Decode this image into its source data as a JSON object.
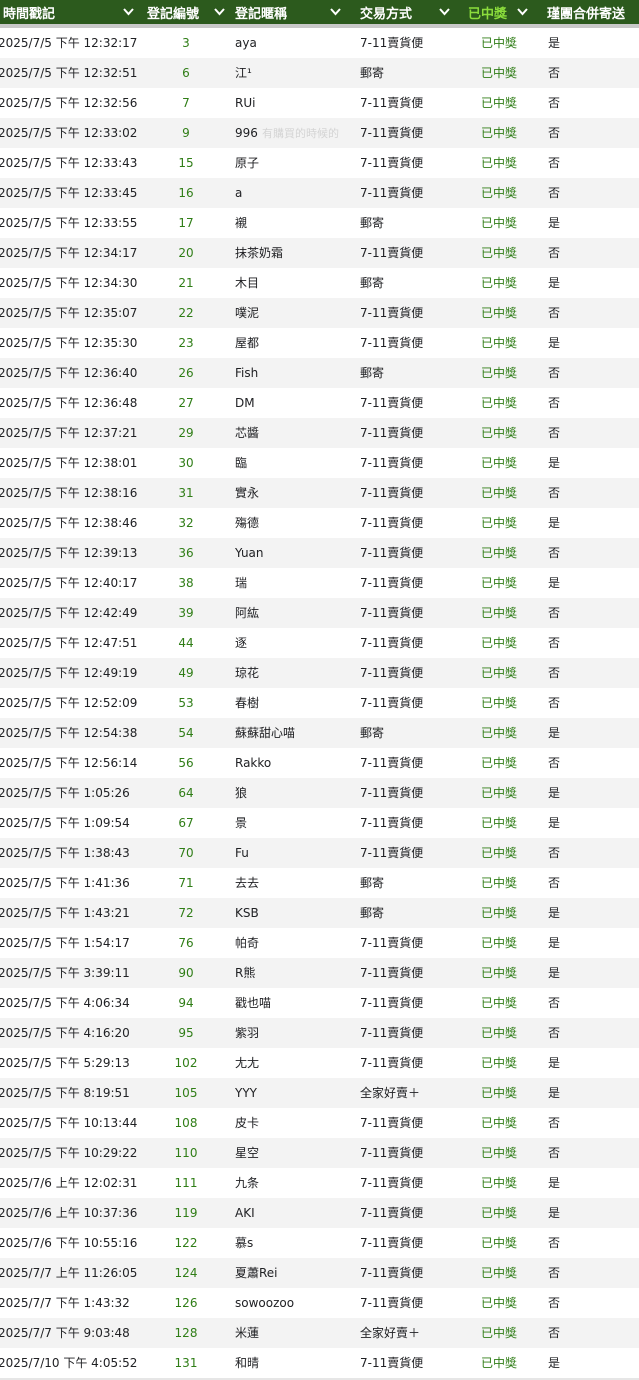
{
  "header": {
    "columns": [
      {
        "label": "時間戳記",
        "icon": "chevron-down-icon"
      },
      {
        "label": "登記編號",
        "icon": "chevron-down-icon"
      },
      {
        "label": "登記暱稱",
        "icon": "chevron-down-icon"
      },
      {
        "label": "交易方式",
        "icon": "chevron-down-icon"
      },
      {
        "label": "已中獎",
        "icon": "chevron-down-icon"
      },
      {
        "label": "瑾團合併寄送"
      }
    ],
    "colors": {
      "background": "#2c5a1d",
      "text": "#ffffff",
      "highlight": "#8bdc3c"
    }
  },
  "ghost_text": "有購買的時候的",
  "rows": [
    {
      "timestamp": "2025/7/5 下午 12:32:17",
      "id": "3",
      "nickname": "aya",
      "method": "7-11賣貨便",
      "status": "已中獎",
      "merge": "是"
    },
    {
      "timestamp": "2025/7/5 下午 12:32:51",
      "id": "6",
      "nickname": "江¹",
      "method": "郵寄",
      "status": "已中獎",
      "merge": "否"
    },
    {
      "timestamp": "2025/7/5 下午 12:32:56",
      "id": "7",
      "nickname": "RUi",
      "method": "7-11賣貨便",
      "status": "已中獎",
      "merge": "否"
    },
    {
      "timestamp": "2025/7/5 下午 12:33:02",
      "id": "9",
      "nickname": "996",
      "method": "7-11賣貨便",
      "status": "已中獎",
      "merge": "否"
    },
    {
      "timestamp": "2025/7/5 下午 12:33:43",
      "id": "15",
      "nickname": "原子",
      "method": "7-11賣貨便",
      "status": "已中獎",
      "merge": "否"
    },
    {
      "timestamp": "2025/7/5 下午 12:33:45",
      "id": "16",
      "nickname": "a",
      "method": "7-11賣貨便",
      "status": "已中獎",
      "merge": "否"
    },
    {
      "timestamp": "2025/7/5 下午 12:33:55",
      "id": "17",
      "nickname": "襯",
      "method": "郵寄",
      "status": "已中獎",
      "merge": "是"
    },
    {
      "timestamp": "2025/7/5 下午 12:34:17",
      "id": "20",
      "nickname": "抹茶奶霜",
      "method": "7-11賣貨便",
      "status": "已中獎",
      "merge": "否"
    },
    {
      "timestamp": "2025/7/5 下午 12:34:30",
      "id": "21",
      "nickname": "木目",
      "method": "郵寄",
      "status": "已中獎",
      "merge": "是"
    },
    {
      "timestamp": "2025/7/5 下午 12:35:07",
      "id": "22",
      "nickname": "噗泥",
      "method": "7-11賣貨便",
      "status": "已中獎",
      "merge": "否"
    },
    {
      "timestamp": "2025/7/5 下午 12:35:30",
      "id": "23",
      "nickname": "屋都",
      "method": "7-11賣貨便",
      "status": "已中獎",
      "merge": "是"
    },
    {
      "timestamp": "2025/7/5 下午 12:36:40",
      "id": "26",
      "nickname": "Fish",
      "method": "郵寄",
      "status": "已中獎",
      "merge": "否"
    },
    {
      "timestamp": "2025/7/5 下午 12:36:48",
      "id": "27",
      "nickname": "DM",
      "method": "7-11賣貨便",
      "status": "已中獎",
      "merge": "否"
    },
    {
      "timestamp": "2025/7/5 下午 12:37:21",
      "id": "29",
      "nickname": "芯醬",
      "method": "7-11賣貨便",
      "status": "已中獎",
      "merge": "否"
    },
    {
      "timestamp": "2025/7/5 下午 12:38:01",
      "id": "30",
      "nickname": "臨",
      "method": "7-11賣貨便",
      "status": "已中獎",
      "merge": "是"
    },
    {
      "timestamp": "2025/7/5 下午 12:38:16",
      "id": "31",
      "nickname": "實永",
      "method": "7-11賣貨便",
      "status": "已中獎",
      "merge": "否"
    },
    {
      "timestamp": "2025/7/5 下午 12:38:46",
      "id": "32",
      "nickname": "殤德",
      "method": "7-11賣貨便",
      "status": "已中獎",
      "merge": "是"
    },
    {
      "timestamp": "2025/7/5 下午 12:39:13",
      "id": "36",
      "nickname": "Yuan",
      "method": "7-11賣貨便",
      "status": "已中獎",
      "merge": "否"
    },
    {
      "timestamp": "2025/7/5 下午 12:40:17",
      "id": "38",
      "nickname": "瑞",
      "method": "7-11賣貨便",
      "status": "已中獎",
      "merge": "是"
    },
    {
      "timestamp": "2025/7/5 下午 12:42:49",
      "id": "39",
      "nickname": "阿紘",
      "method": "7-11賣貨便",
      "status": "已中獎",
      "merge": "否"
    },
    {
      "timestamp": "2025/7/5 下午 12:47:51",
      "id": "44",
      "nickname": "逐",
      "method": "7-11賣貨便",
      "status": "已中獎",
      "merge": "否"
    },
    {
      "timestamp": "2025/7/5 下午 12:49:19",
      "id": "49",
      "nickname": "琼花",
      "method": "7-11賣貨便",
      "status": "已中獎",
      "merge": "否"
    },
    {
      "timestamp": "2025/7/5 下午 12:52:09",
      "id": "53",
      "nickname": "春樹",
      "method": "7-11賣貨便",
      "status": "已中獎",
      "merge": "否"
    },
    {
      "timestamp": "2025/7/5 下午 12:54:38",
      "id": "54",
      "nickname": "蘇蘇甜心喵",
      "method": "郵寄",
      "status": "已中獎",
      "merge": "是"
    },
    {
      "timestamp": "2025/7/5 下午 12:56:14",
      "id": "56",
      "nickname": "Rakko",
      "method": "7-11賣貨便",
      "status": "已中獎",
      "merge": "否"
    },
    {
      "timestamp": "2025/7/5 下午 1:05:26",
      "id": "64",
      "nickname": "狼",
      "method": "7-11賣貨便",
      "status": "已中獎",
      "merge": "是"
    },
    {
      "timestamp": "2025/7/5 下午 1:09:54",
      "id": "67",
      "nickname": "景",
      "method": "7-11賣貨便",
      "status": "已中獎",
      "merge": "是"
    },
    {
      "timestamp": "2025/7/5 下午 1:38:43",
      "id": "70",
      "nickname": "Fu",
      "method": "7-11賣貨便",
      "status": "已中獎",
      "merge": "否"
    },
    {
      "timestamp": "2025/7/5 下午 1:41:36",
      "id": "71",
      "nickname": "去去",
      "method": "郵寄",
      "status": "已中獎",
      "merge": "否"
    },
    {
      "timestamp": "2025/7/5 下午 1:43:21",
      "id": "72",
      "nickname": "KSB",
      "method": "郵寄",
      "status": "已中獎",
      "merge": "是"
    },
    {
      "timestamp": "2025/7/5 下午 1:54:17",
      "id": "76",
      "nickname": "帕奇",
      "method": "7-11賣貨便",
      "status": "已中獎",
      "merge": "是"
    },
    {
      "timestamp": "2025/7/5 下午 3:39:11",
      "id": "90",
      "nickname": "R熊",
      "method": "7-11賣貨便",
      "status": "已中獎",
      "merge": "是"
    },
    {
      "timestamp": "2025/7/5 下午 4:06:34",
      "id": "94",
      "nickname": "戳也喵",
      "method": "7-11賣貨便",
      "status": "已中獎",
      "merge": "否"
    },
    {
      "timestamp": "2025/7/5 下午 4:16:20",
      "id": "95",
      "nickname": "紫羽",
      "method": "7-11賣貨便",
      "status": "已中獎",
      "merge": "否"
    },
    {
      "timestamp": "2025/7/5 下午 5:29:13",
      "id": "102",
      "nickname": "尢尢",
      "method": "7-11賣貨便",
      "status": "已中獎",
      "merge": "是"
    },
    {
      "timestamp": "2025/7/5 下午 8:19:51",
      "id": "105",
      "nickname": "YYY",
      "method": "全家好賣＋",
      "status": "已中獎",
      "merge": "是"
    },
    {
      "timestamp": "2025/7/5 下午 10:13:44",
      "id": "108",
      "nickname": "皮卡",
      "method": "7-11賣貨便",
      "status": "已中獎",
      "merge": "否"
    },
    {
      "timestamp": "2025/7/5 下午 10:29:22",
      "id": "110",
      "nickname": "星空",
      "method": "7-11賣貨便",
      "status": "已中獎",
      "merge": "否"
    },
    {
      "timestamp": "2025/7/6 上午 12:02:31",
      "id": "111",
      "nickname": "九条",
      "method": "7-11賣貨便",
      "status": "已中獎",
      "merge": "是"
    },
    {
      "timestamp": "2025/7/6 上午 10:37:36",
      "id": "119",
      "nickname": "AKI",
      "method": "7-11賣貨便",
      "status": "已中獎",
      "merge": "是"
    },
    {
      "timestamp": "2025/7/6 下午 10:55:16",
      "id": "122",
      "nickname": "慕s",
      "method": "7-11賣貨便",
      "status": "已中獎",
      "merge": "否"
    },
    {
      "timestamp": "2025/7/7 上午 11:26:05",
      "id": "124",
      "nickname": "夏蕭Rei",
      "method": "7-11賣貨便",
      "status": "已中獎",
      "merge": "否"
    },
    {
      "timestamp": "2025/7/7 下午 1:43:32",
      "id": "126",
      "nickname": "sowoozoo",
      "method": "7-11賣貨便",
      "status": "已中獎",
      "merge": "否"
    },
    {
      "timestamp": "2025/7/7 下午 9:03:48",
      "id": "128",
      "nickname": "米蓮",
      "method": "全家好賣＋",
      "status": "已中獎",
      "merge": "否"
    },
    {
      "timestamp": "2025/7/10 下午 4:05:52",
      "id": "131",
      "nickname": "和晴",
      "method": "7-11賣貨便",
      "status": "已中獎",
      "merge": "是"
    }
  ]
}
